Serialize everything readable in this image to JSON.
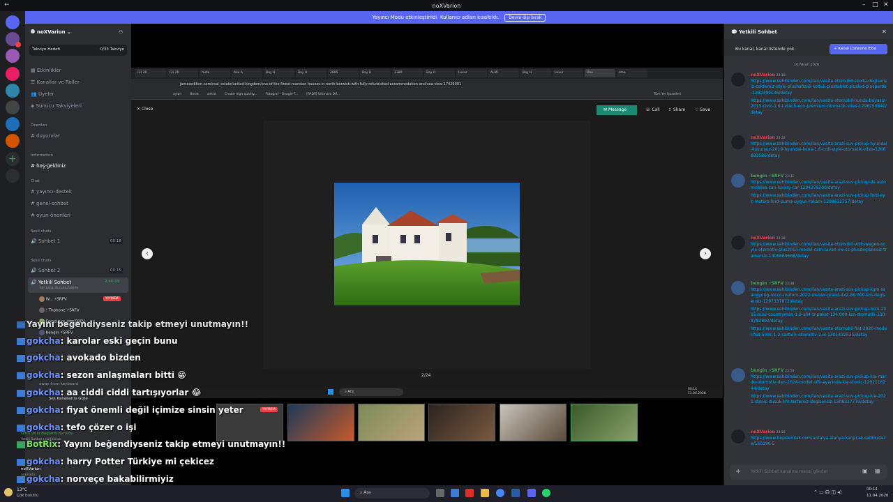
{
  "window": {
    "title": "noXVarion"
  },
  "banner": {
    "text": "Yayıncı Modu etkinleştirildi. Kullanıcı adları kısaltıldı.",
    "button": "Devre dışı bırak"
  },
  "server": {
    "name": "noXVarion",
    "boost_label": "Takviye Hedefi",
    "boost_value": "0/33 Takviye",
    "menu": [
      "Etkinlikler",
      "Kanallar ve Roller",
      "Üyeler",
      "Sunucu Takviyeleri"
    ],
    "cat_featured": "Önerilen",
    "featured": [
      "duyurular"
    ],
    "cat_info": "Information",
    "info": [
      "hoş-geldiniz"
    ],
    "cat_chat": "Chat",
    "chat": [
      "yayıncı-destek",
      "genel-sohbet",
      "oyun-önerileri"
    ],
    "cat_voice": "Sesli chats",
    "voice1": "Sohbet 1",
    "voice1_users": "00",
    "voice1_cnt": "18",
    "cat_voice2": "Sesli chats",
    "voice2": "Sohbet 2",
    "voice2_users": "00",
    "voice2_cnt": "15",
    "active_channel": "Yetkili Sohbet",
    "active_time": "2:46:09",
    "active_status": "Bir kanal durumu belirle",
    "voice_users": [
      {
        "name": "W... ⚡SRFV",
        "live": "YAYINDA"
      },
      {
        "name": "! Thphone ⚡SRFV"
      },
      {
        "name": "Femzi.exe 🎮 ⚡SRFV"
      },
      {
        "name": "bengin ⚡SRFV"
      }
    ],
    "away": "away from keyboard",
    "sound_label": "Ses Kanallarını Gizle",
    "conn": "Görüntülü Bağlantı Kuruldu",
    "conn_sub": "Yetkili Sohbet / noXVarion",
    "user": "noXVarion",
    "user_status": "aramada"
  },
  "browser": {
    "tabs": [
      "(3) 20",
      "(3) 20",
      "tadia",
      "Aile A",
      "Bay H",
      "Bay H",
      "2885",
      "Bay H",
      "1380",
      "Bay H",
      "Luxur",
      "ALMI",
      "Bay H",
      "Luxur",
      "One",
      "stoa"
    ],
    "url": "jamesedition.com/real_estate/united-kingdom/one-of-the-finest-mansion-houses-in-north-berwick-with-fully-refurbished-accommodation-and-sea-view-17429091",
    "bookmarks": [
      "ayları",
      "Berat",
      "ankrit",
      "Create high quality...",
      "Fotoğraf - Google F...",
      "[PADS] Ultimate Dif...",
      "Tüm Yer İşaretleri"
    ],
    "close": "Close",
    "message": "Message",
    "call": "Call",
    "share": "Share",
    "save": "Save",
    "counter": "2/24",
    "search": "Ara",
    "clock_time": "00:14",
    "clock_date": "11.04.2026"
  },
  "chat_overlay": [
    {
      "user": "",
      "text": "Yayını beğendiyseniz takip etmeyi unutmayın!!",
      "color": "#ffffff"
    },
    {
      "user": "gokcha",
      "text": ": karolar eski geçin bunu",
      "color": "#6f8fff"
    },
    {
      "user": "gokcha",
      "text": ": avokado bizden",
      "color": "#6f8fff"
    },
    {
      "user": "gokcha",
      "text": ": sezon anlaşmaları bitti 😁",
      "color": "#6f8fff"
    },
    {
      "user": "gokcha",
      "text": ": aa ciddi ciddi tartışıyorlar 😂",
      "color": "#6f8fff"
    },
    {
      "user": "gokcha",
      "text": ": fiyat önemli değil içimize sinsin yeter",
      "color": "#6f8fff"
    },
    {
      "user": "gokcha",
      "text": ": tefo çözer o işi",
      "color": "#6f8fff"
    },
    {
      "user": "BotRix",
      "text": ": Yayını beğendiyseniz takip etmeyi unutmayın!!",
      "color": "#7ee36b"
    },
    {
      "user": "gokcha",
      "text": ": harry Potter Türkiye mi çekicez",
      "color": "#6f8fff"
    },
    {
      "user": "gokcha",
      "text": ": norveçe bakabilirmiyiz",
      "color": "#6f8fff"
    }
  ],
  "cams": {
    "live": "YAYINDA"
  },
  "right": {
    "title": "Yetkili Sohbet",
    "notice": "Bu kanal, kanal listende yok.",
    "add_button": "Kanal Listesine Ekle",
    "date": "10 Nisan 2026",
    "input_placeholder": "Yetkili Sohbet kanalına mesaj gönder",
    "messages": [
      {
        "author": "noXVarion",
        "time": "23:18",
        "color": "#f23f43",
        "links": [
          "https://www.sahibinden.com/ilan/vasita-otomobil-skoda-degisensiz-coktemiz-style-plushafizali-koltuk-plustablet-plusled-plusperde-1292499136/detay",
          "https://www.sahibinden.com/ilan/vasita-otomobil-honda-boyasiz-2015-civic-1.6-i-vtech-eco-premium-otomatik-vites-1298250840/detay"
        ]
      },
      {
        "author": "noXVarion",
        "time": "23:32",
        "color": "#f23f43",
        "links": [
          "https://www.sahibinden.com/ilan/vasita-arazi-suv-pickup-hyundai-kusursuz-2019-hyundai-kona-1.6-crdi-style-otomatik-vites-1266683586/detay"
        ]
      },
      {
        "author": "bengin ⚡SRFV",
        "time": "23:32",
        "color": "#3ba55c",
        "links": [
          "https://www.sahibinden.com/ilan/vasita-arazi-suv-pickup-ds-automobiles-can-luxury-car-1294379200/detay",
          "https://www.sahibinden.com/ilan/vasita-arazi-suv-pickup-ford-eyc-motors-ford-puma-uygun-rakam-1308632757/detay"
        ]
      },
      {
        "author": "noXVarion",
        "time": "23:38",
        "color": "#f23f43",
        "links": [
          "https://www.sahibinden.com/ilan/vasita-otomobil-volkswagen-soyla-otomotiv-plus2013-model-cam-tavan-vw-cc-plusdegisensiz-tramersiz-1305869688/detay"
        ]
      },
      {
        "author": "bengin ⚡SRFV",
        "time": "23:38",
        "color": "#3ba55c",
        "links": [
          "https://www.sahibinden.com/ilan/vasita-arazi-suv-pickup-kgm-ssangyong-rocco-motors-2022-musso-grand-4x2-86.000-km-degisensiz-1297337872/detay",
          "https://www.sahibinden.com/ilan/vasita-arazi-suv-pickup-mini-2015-mini-countryman-1.6-all4-tr-paket-134.000-km-otomatik-1308782892/detay",
          "https://www.sahibinden.com/ilan/vasita-otomobil-fiat-2020-model-fiat-500c-1.2-sarturk-otomotiv-2.el-1301432535/detay"
        ]
      },
      {
        "author": "bengin ⚡SRFV",
        "time": "23:50",
        "color": "#3ba55c",
        "links": [
          "https://www.sahibinden.com/ilan/vasita-arazi-suv-pickup-kia-marde-otomotiv-den-2024-model-sifir-ayarinda-kia-stonic-1292116244/detay",
          "https://www.sahibinden.com/ilan/vasita-arazi-suv-pickup-kia-2021-stonic-dusuk-km-tertemiz-degisensiz-1308327770/detay"
        ]
      },
      {
        "author": "noXVarion",
        "time": "23:55",
        "color": "#f23f43",
        "links": [
          "https://www.hepsiemlak.com/antalya-alanya-kargicak-satilik/daire/160190-5"
        ]
      }
    ]
  },
  "taskbar": {
    "weather_temp": "13°C",
    "weather_text": "Çok bulutlu",
    "search": "Ara",
    "time": "00:14",
    "date": "11.04.2026"
  },
  "colors": {
    "accent": "#5865f2",
    "link": "#00a8fc",
    "live": "#f23f43"
  }
}
